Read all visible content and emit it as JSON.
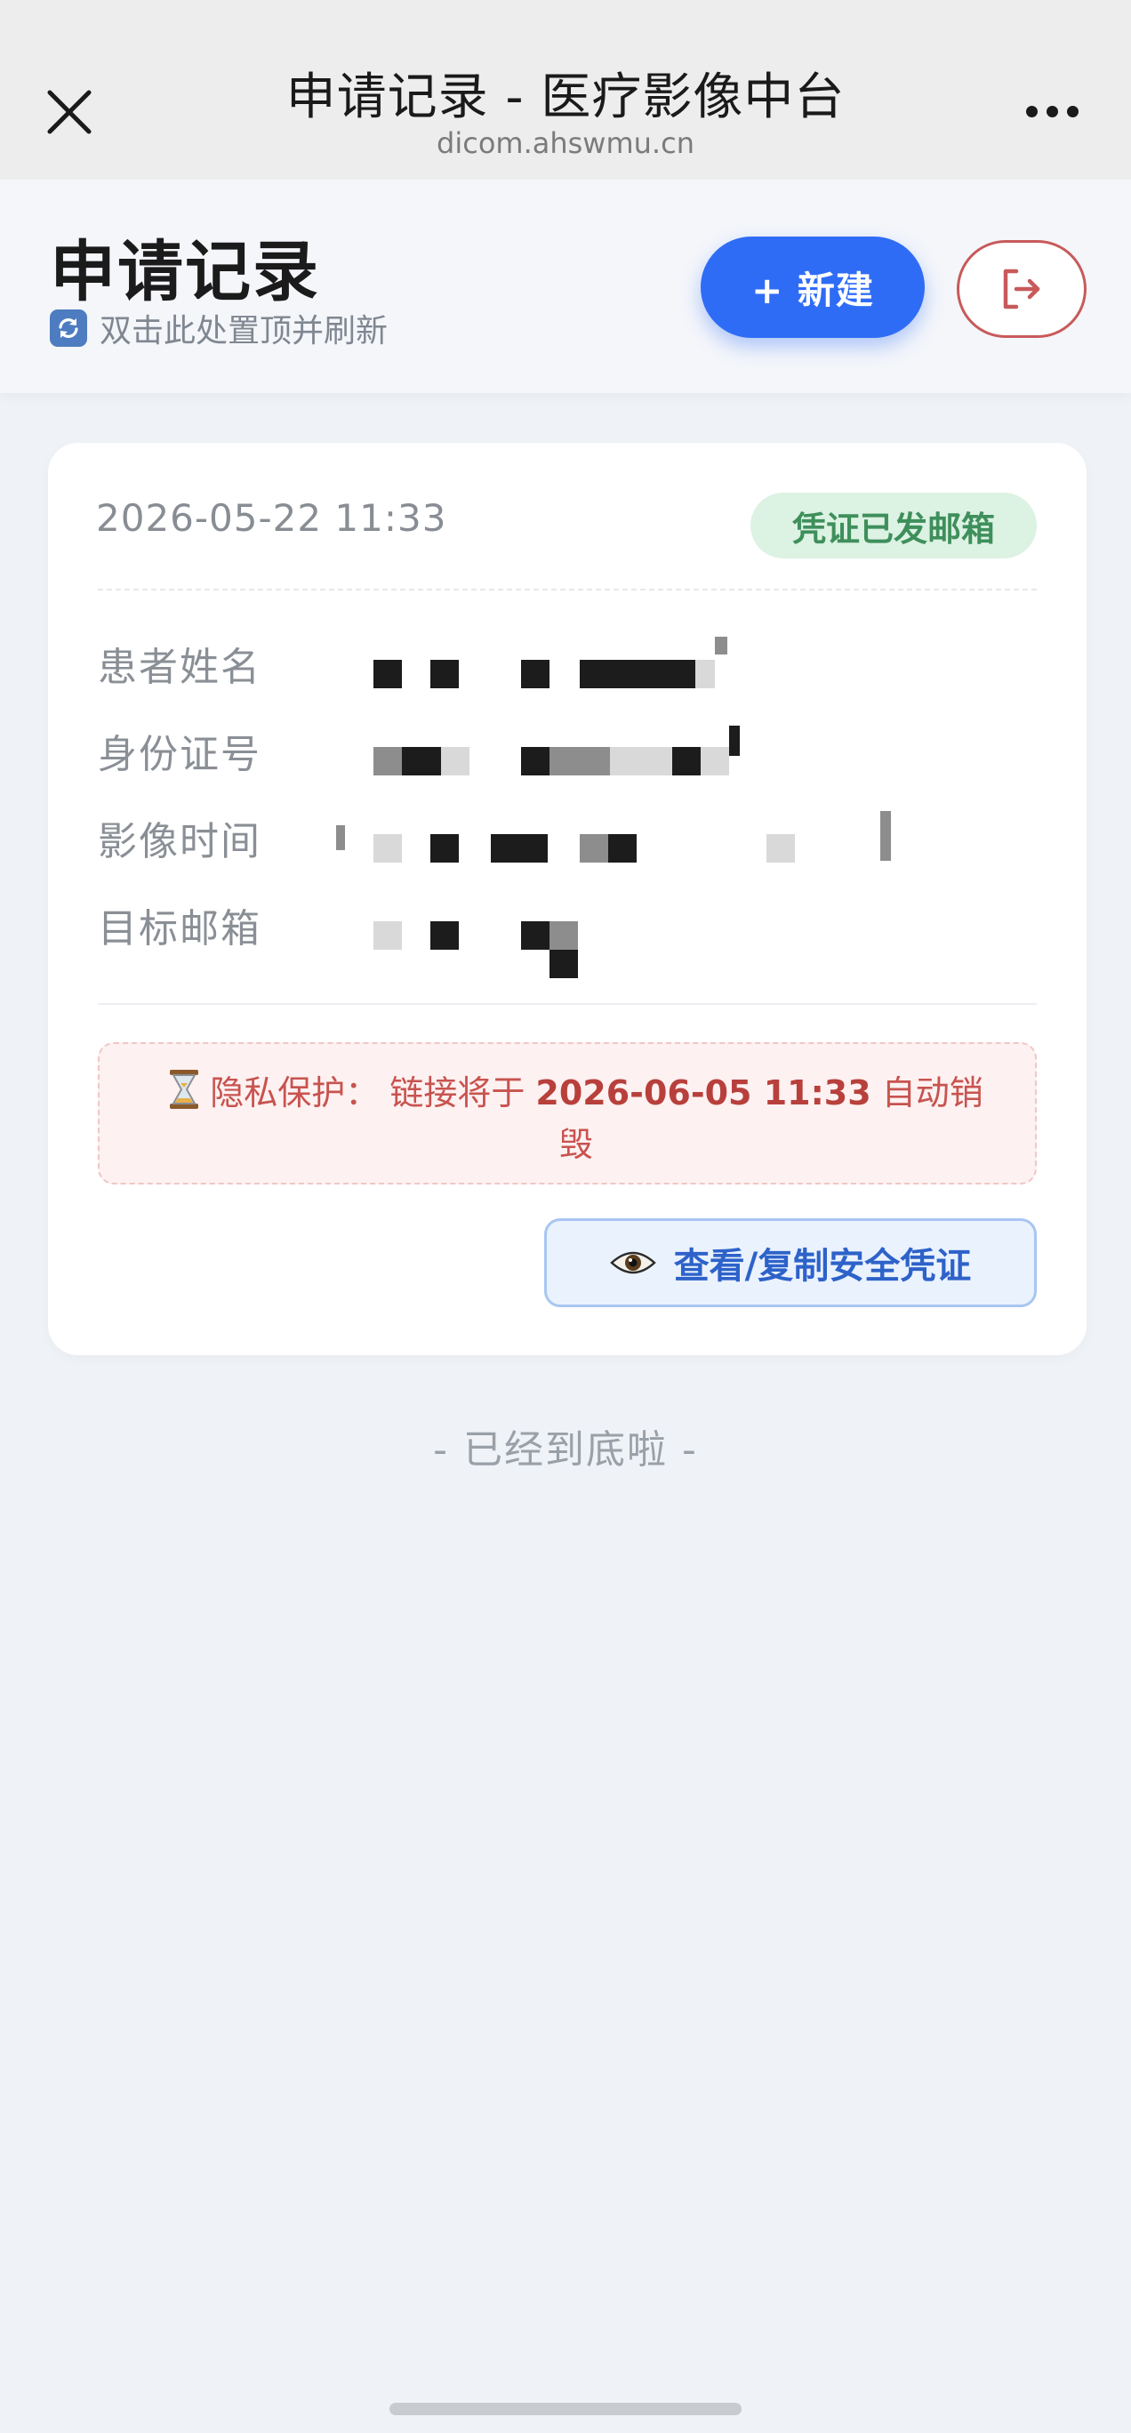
{
  "browser": {
    "title": "申请记录 - 医疗影像中台",
    "domain": "dicom.ahswmu.cn"
  },
  "header": {
    "title": "申请记录",
    "refresh_hint": "双击此处置顶并刷新",
    "new_label": "+ 新建"
  },
  "record": {
    "date": "2026-05-22 11:33",
    "status": "凭证已发邮箱",
    "fields": [
      {
        "label": "患者姓名"
      },
      {
        "label": "身份证号"
      },
      {
        "label": "影像时间"
      },
      {
        "label": "目标邮箱"
      }
    ],
    "privacy_prefix": "隐私保护：  链接将于 ",
    "privacy_date": "2026-06-05 11:33",
    "privacy_suffix": " 自动销毁",
    "view_label": "查看/复制安全凭证"
  },
  "footer": {
    "end_text": "- 已经到底啦 -"
  },
  "colors": {
    "primary": "#2f6cf6",
    "success_bg": "#dcf2e3",
    "success_text": "#3e8f5b",
    "danger": "#c85a5a",
    "background": "#eff2f7"
  },
  "icons": {
    "close": "close-icon",
    "more": "more-icon",
    "refresh": "refresh-icon",
    "logout": "logout-icon",
    "hourglass": "hourglass-icon",
    "eye": "eye-icon"
  }
}
